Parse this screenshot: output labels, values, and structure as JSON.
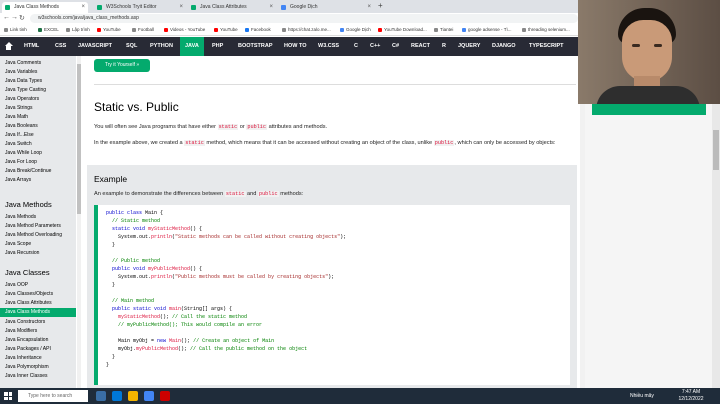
{
  "browser": {
    "tabs": [
      {
        "label": "Java Class Methods",
        "active": true
      },
      {
        "label": "W3Schools Tryit Editor",
        "active": false
      },
      {
        "label": "Java Class Attributes",
        "active": false
      },
      {
        "label": "Google Dịch",
        "active": false
      }
    ],
    "url": "w3schools.com/java/java_class_methods.asp",
    "bookmarks": [
      "Link tinh",
      "EXCEL",
      "Lập trình",
      "YouTube",
      "Football",
      "Videos - YouTube",
      "YouTube",
      "Facebook",
      "https://chat.zalo.me...",
      "Google Dịch",
      "YouTube Download...",
      "Tiantei",
      "google adsense - Tì...",
      "threading selenium..."
    ]
  },
  "topnav": {
    "items": [
      "HTML",
      "CSS",
      "JAVASCRIPT",
      "SQL",
      "PYTHON",
      "JAVA",
      "PHP",
      "BOOTSTRAP",
      "HOW TO",
      "W3.CSS",
      "C",
      "C++",
      "C#",
      "REACT",
      "R",
      "JQUERY",
      "DJANGO",
      "TYPESCRIPT"
    ],
    "active": "JAVA"
  },
  "sidebar": {
    "items_top": [
      "Java Comments",
      "Java Variables",
      "Java Data Types",
      "Java Type Casting",
      "Java Operators",
      "Java Strings",
      "Java Math",
      "Java Booleans",
      "Java If...Else",
      "Java Switch",
      "Java While Loop",
      "Java For Loop",
      "Java Break/Continue",
      "Java Arrays"
    ],
    "heading_methods": "Java Methods",
    "items_methods": [
      "Java Methods",
      "Java Method Parameters",
      "Java Method Overloading",
      "Java Scope",
      "Java Recursion"
    ],
    "heading_classes": "Java Classes",
    "items_classes": [
      "Java OOP",
      "Java Classes/Objects",
      "Java Class Attributes",
      "Java Class Methods",
      "Java Constructors",
      "Java Modifiers",
      "Java Encapsulation",
      "Java Packages / API",
      "Java Inheritance",
      "Java Polymorphism",
      "Java Inner Classes"
    ],
    "active": "Java Class Methods"
  },
  "main": {
    "tryit_label": "Try it Yourself »",
    "title": "Static vs. Public",
    "p1_a": "You will often see Java programs that have either ",
    "p1_kw1": "static",
    "p1_b": " or ",
    "p1_kw2": "public",
    "p1_c": " attributes and methods.",
    "p2_a": "In the example above, we created a ",
    "p2_kw1": "static",
    "p2_b": " method, which means that it can be accessed without creating an object of the class, unlike ",
    "p2_kw2": "public",
    "p2_c": ", which can only be accessed by objects:",
    "example_title": "Example",
    "example_a": "An example to demonstrate the differences between ",
    "example_kw1": "static",
    "example_b": " and ",
    "example_kw2": "public",
    "example_c": " methods:"
  },
  "code": {
    "lines": [
      {
        "k": "public class ",
        "t": "Main {"
      },
      {
        "c": "  // Static method"
      },
      {
        "k": "  static void ",
        "f": "myStaticMethod",
        "t": "() {"
      },
      {
        "t": "    System.out.",
        "f": "println",
        "p": "(",
        "s": "\"Static methods can be called without creating objects\"",
        "e": ");"
      },
      {
        "t": "  }"
      },
      {
        "t": ""
      },
      {
        "c": "  // Public method"
      },
      {
        "k": "  public void ",
        "f": "myPublicMethod",
        "t": "() {"
      },
      {
        "t": "    System.out.",
        "f": "println",
        "p": "(",
        "s": "\"Public methods must be called by creating objects\"",
        "e": ");"
      },
      {
        "t": "  }"
      },
      {
        "t": ""
      },
      {
        "c": "  // Main method"
      },
      {
        "k": "  public static void ",
        "f": "main",
        "t": "(String[] args) {"
      },
      {
        "f": "    myStaticMethod",
        "t": "(); ",
        "c2": "// Call the static method"
      },
      {
        "c": "    // myPublicMethod(); This would compile an error"
      },
      {
        "t": ""
      },
      {
        "t": "    Main myObj = ",
        "k2": "new ",
        "f": "Main",
        "t2": "(); ",
        "c2": "// Create an object of Main"
      },
      {
        "t": "    myObj.",
        "f": "myPublicMethod",
        "t2": "(); ",
        "c2": "// Call the public method on the object"
      },
      {
        "t": "  }"
      },
      {
        "t": "}"
      }
    ]
  },
  "taskbar": {
    "search_placeholder": "Type here to search",
    "lang": "Nhiều mây",
    "time": "7:47 AM",
    "date": "12/12/2022"
  },
  "colors": {
    "accent": "#04aa6d",
    "topnav": "#282a35",
    "sidebar": "#e7e9eb"
  }
}
